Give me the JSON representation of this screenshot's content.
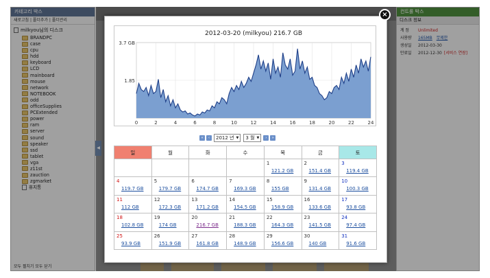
{
  "left_panel": {
    "title": "카테고리 박스",
    "toolbar": "새로고침 | 폴더추가 | 폴더관리",
    "root_label": "milkyou님의 디스크",
    "folders": [
      "BRANDPC",
      "case",
      "cpu",
      "hdd",
      "keyboard",
      "LCD",
      "mainboard",
      "mouse",
      "network",
      "NOTEBOOK",
      "odd",
      "officeSupplies",
      "PCExtended",
      "power",
      "ram",
      "server",
      "sound",
      "speaker",
      "ssd",
      "tablet",
      "vga",
      "z11st",
      "zauction",
      "zgmarket"
    ],
    "trash_label": "휴지통",
    "footer": "모두 펼치기   모두 닫기"
  },
  "right_panel": {
    "title": "컨트롤 박스",
    "subtitle": "디스크 정보",
    "rows": [
      {
        "key": "계 정",
        "value": "Unlimited",
        "red": true
      },
      {
        "key": "사용량",
        "value": "165MB",
        "link": "무제한"
      },
      {
        "key": "생성일",
        "value": "2012-03-30"
      },
      {
        "key": "만료일",
        "value": "2012-12-30",
        "extra": "[서비스 연장]"
      }
    ]
  },
  "modal": {
    "close_label": "×",
    "year_select": "2012 년",
    "month_select": "3 월",
    "nav_first": "«",
    "nav_prev": "‹",
    "nav_next": "›",
    "nav_last": "»"
  },
  "chart_data": {
    "type": "area",
    "title": "2012-03-20 (milkyou) 216.7 GB",
    "xlabel": "",
    "ylabel": "",
    "xlim": [
      0,
      24
    ],
    "ylim": [
      0,
      3.7
    ],
    "x_ticks": [
      "0",
      "2",
      "4",
      "6",
      "8",
      "10",
      "12",
      "14",
      "16",
      "18",
      "20",
      "22",
      "24"
    ],
    "y_ticks": [
      "3.7 GB",
      "1.85",
      ""
    ],
    "fill_color": "#7b9fd0",
    "line_color": "#1e3f88",
    "grid": true,
    "x": [
      0,
      0.25,
      0.5,
      0.75,
      1,
      1.25,
      1.5,
      1.75,
      2,
      2.25,
      2.5,
      2.75,
      3,
      3.25,
      3.5,
      3.75,
      4,
      4.25,
      4.5,
      4.75,
      5,
      5.25,
      5.5,
      5.75,
      6,
      6.25,
      6.5,
      6.75,
      7,
      7.25,
      7.5,
      7.75,
      8,
      8.25,
      8.5,
      8.75,
      9,
      9.25,
      9.5,
      9.75,
      10,
      10.25,
      10.5,
      10.75,
      11,
      11.25,
      11.5,
      11.75,
      12,
      12.25,
      12.5,
      12.75,
      13,
      13.25,
      13.5,
      13.75,
      14,
      14.25,
      14.5,
      14.75,
      15,
      15.25,
      15.5,
      15.75,
      16,
      16.25,
      16.5,
      16.75,
      17,
      17.25,
      17.5,
      17.75,
      18,
      18.25,
      18.5,
      18.75,
      19,
      19.25,
      19.5,
      19.75,
      20,
      20.25,
      20.5,
      20.75,
      21,
      21.25,
      21.5,
      21.75,
      22,
      22.25,
      22.5,
      22.75,
      23,
      23.25,
      23.5,
      23.75,
      24
    ],
    "values": [
      1.2,
      1.7,
      1.4,
      1.3,
      1.5,
      1.1,
      1.6,
      1.2,
      1.3,
      1.9,
      1.0,
      1.4,
      0.8,
      1.1,
      0.6,
      0.9,
      0.5,
      0.7,
      0.4,
      0.3,
      0.35,
      0.2,
      0.25,
      0.15,
      0.1,
      0.2,
      0.15,
      0.3,
      0.25,
      0.4,
      0.35,
      0.6,
      0.5,
      0.8,
      0.7,
      1.0,
      0.9,
      0.7,
      1.2,
      1.5,
      1.3,
      1.6,
      1.4,
      1.8,
      1.5,
      1.7,
      2.0,
      1.8,
      2.2,
      2.6,
      3.1,
      2.4,
      2.8,
      2.3,
      2.7,
      1.9,
      2.9,
      2.2,
      2.5,
      2.0,
      3.2,
      2.6,
      2.4,
      2.9,
      2.1,
      2.3,
      3.4,
      2.4,
      2.8,
      2.2,
      2.5,
      1.9,
      2.0,
      1.6,
      1.5,
      1.2,
      1.1,
      0.9,
      1.0,
      1.3,
      1.2,
      1.5,
      1.6,
      1.4,
      2.0,
      1.7,
      2.2,
      1.8,
      2.4,
      2.0,
      2.6,
      2.2,
      2.9,
      2.5,
      2.8,
      2.3,
      3.0,
      2.6,
      2.3
    ]
  },
  "calendar": {
    "weekdays": [
      "일",
      "월",
      "화",
      "수",
      "목",
      "금",
      "토"
    ],
    "weeks": [
      [
        null,
        null,
        null,
        null,
        {
          "day": "1",
          "value": "121.2 GB"
        },
        {
          "day": "2",
          "value": "151.4 GB"
        },
        {
          "day": "3",
          "value": "119.4 GB"
        }
      ],
      [
        {
          "day": "4",
          "value": "119.7 GB"
        },
        {
          "day": "5",
          "value": "179.7 GB"
        },
        {
          "day": "6",
          "value": "174.7 GB"
        },
        {
          "day": "7",
          "value": "169.3 GB"
        },
        {
          "day": "8",
          "value": "155 GB"
        },
        {
          "day": "9",
          "value": "131.4 GB"
        },
        {
          "day": "10",
          "value": "100.3 GB"
        }
      ],
      [
        {
          "day": "11",
          "value": "112 GB"
        },
        {
          "day": "12",
          "value": "172.3 GB"
        },
        {
          "day": "13",
          "value": "171.2 GB"
        },
        {
          "day": "14",
          "value": "154.5 GB"
        },
        {
          "day": "15",
          "value": "158.9 GB"
        },
        {
          "day": "16",
          "value": "133.6 GB"
        },
        {
          "day": "17",
          "value": "93.8 GB"
        }
      ],
      [
        {
          "day": "18",
          "value": "102.8 GB"
        },
        {
          "day": "19",
          "value": "174 GB"
        },
        {
          "day": "20",
          "value": "216.7 GB",
          "visited": true
        },
        {
          "day": "21",
          "value": "188.3 GB"
        },
        {
          "day": "22",
          "value": "164.3 GB"
        },
        {
          "day": "23",
          "value": "141.5 GB"
        },
        {
          "day": "24",
          "value": "97.4 GB"
        }
      ],
      [
        {
          "day": "25",
          "value": "93.9 GB"
        },
        {
          "day": "26",
          "value": "151.9 GB"
        },
        {
          "day": "27",
          "value": "161.8 GB"
        },
        {
          "day": "28",
          "value": "148.9 GB"
        },
        {
          "day": "29",
          "value": "156.6 GB"
        },
        {
          "day": "30",
          "value": "140 GB"
        },
        {
          "day": "31",
          "value": "91.6 GB"
        }
      ]
    ]
  }
}
